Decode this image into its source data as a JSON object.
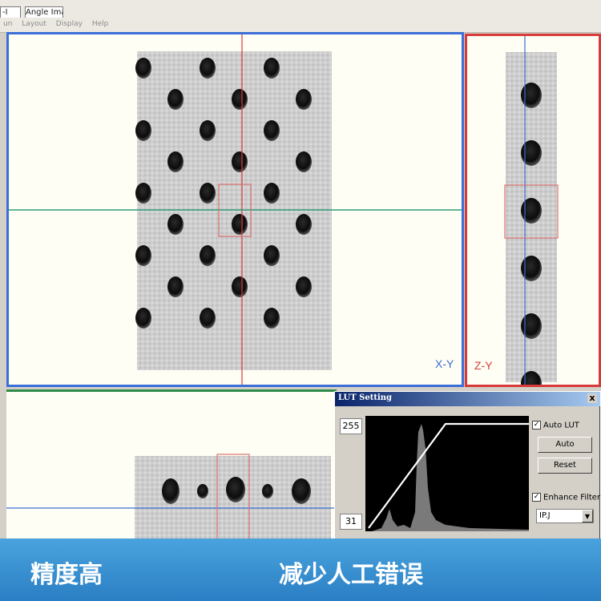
{
  "tabs": {
    "left_label": "-I",
    "angle_label": "Angle Image"
  },
  "menu": [
    "un",
    "Layout",
    "Display",
    "Help"
  ],
  "views": {
    "xy_label": "X-Y",
    "zy_label": "Z-Y",
    "accent_blue": "#3a6fd8",
    "accent_red": "#d83a3a",
    "accent_green": "#2f8c4a"
  },
  "lut": {
    "title": "LUT Setting",
    "close": "x",
    "max_value": "255",
    "min_value": "31",
    "auto_lut_label": "Auto LUT",
    "auto_lut_checked": "✓",
    "auto_button": "Auto",
    "reset_button": "Reset",
    "enhance_label": "Enhance Filter",
    "enhance_checked": "✓",
    "filter_value": "IP.J"
  },
  "banner": {
    "left_text": "精度高",
    "right_text": "减少人工错误"
  }
}
